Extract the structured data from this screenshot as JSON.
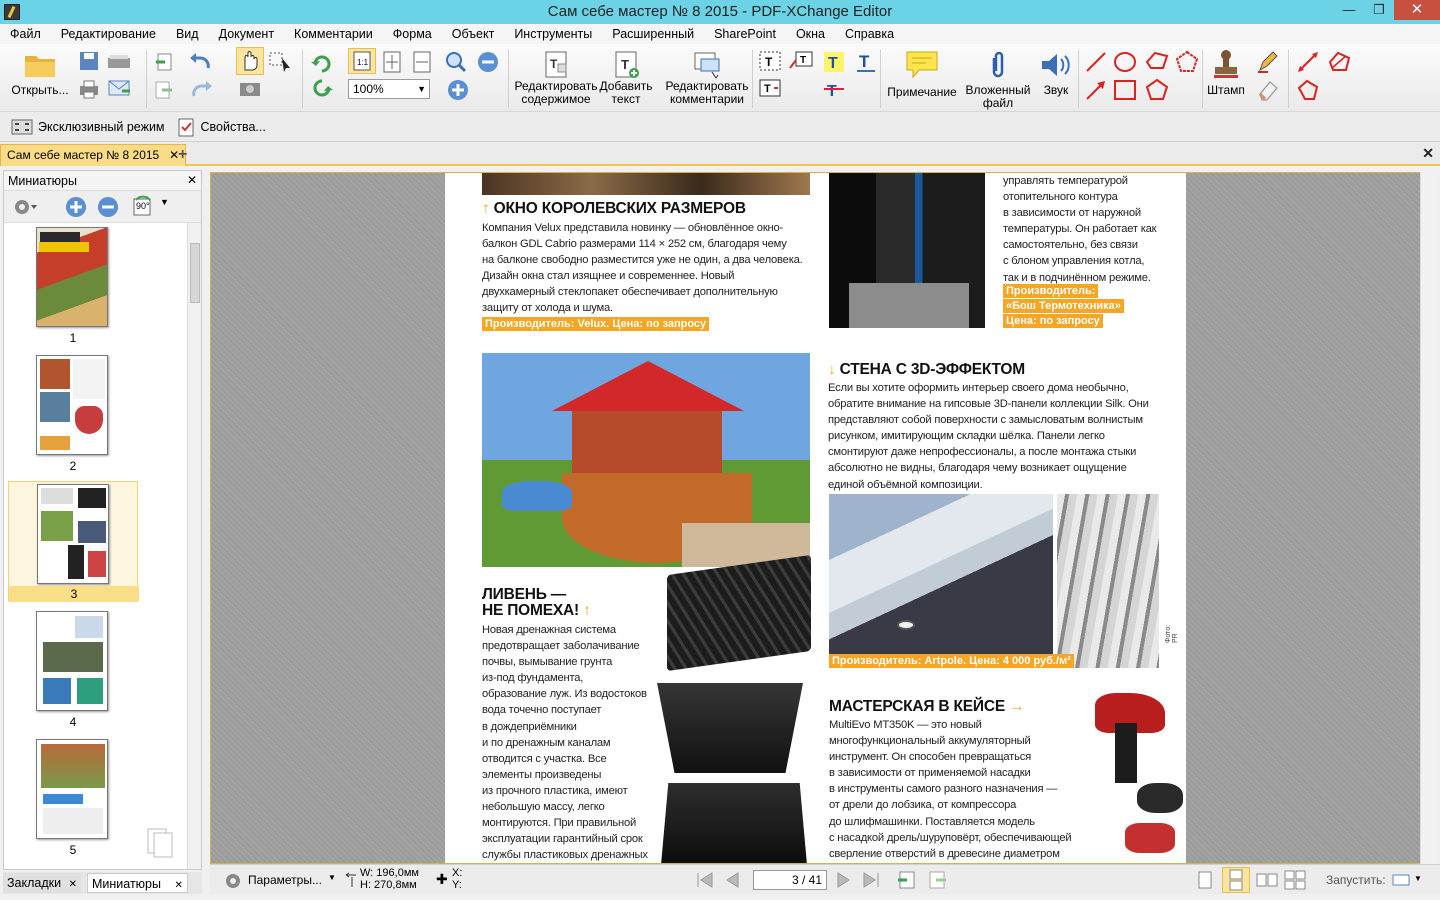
{
  "window": {
    "title": "Сам себе мастер № 8 2015 - PDF-XChange Editor"
  },
  "menu": [
    "Файл",
    "Редактирование",
    "Вид",
    "Документ",
    "Комментарии",
    "Форма",
    "Объект",
    "Инструменты",
    "Расширенный",
    "SharePoint",
    "Окна",
    "Справка"
  ],
  "toolbar": {
    "open": "Открыть...",
    "zoom_value": "100%",
    "edit_content_1": "Редактировать",
    "edit_content_2": "содержимое",
    "add_text_1": "Добавить",
    "add_text_2": "текст",
    "edit_comments_1": "Редактировать",
    "edit_comments_2": "комментарии",
    "note": "Примечание",
    "attach_1": "Вложенный",
    "attach_2": "файл",
    "sound": "Звук",
    "stamp": "Штамп"
  },
  "toolbar2": {
    "exclusive": "Эксклюзивный режим",
    "properties": "Свойства..."
  },
  "tab": {
    "doc": "Сам себе мастер № 8 2015"
  },
  "panel": {
    "title": "Миниатюры",
    "rotate": "90°",
    "thumbs": [
      "1",
      "2",
      "3",
      "4",
      "5"
    ],
    "tab_bookmarks": "Закладки",
    "tab_thumbs": "Миниатюры"
  },
  "article": {
    "h1": "ОКНО КОРОЛЕВСКИХ РАЗМЕРОВ",
    "p1": [
      "Компания Velux представила новинку — обновлённое окно-",
      "балкон GDL Cabrio размерами 114 × 252 см, благодаря чему",
      "на балконе свободно разместится уже не один, а два человека.",
      "Дизайн окна стал изящнее и современнее. Новый",
      "двухкамерный стеклопакет обеспечивает дополнительную",
      "защиту от холода и шума."
    ],
    "tag1": "Производитель: Velux. Цена: по запросу",
    "p_right": [
      "управлять температурой",
      "отопительного контура",
      "в зависимости от наружной",
      "температуры. Он работает как",
      "самостоятельно, без связи",
      "с блоном управления котла,",
      "так и в подчинённом режиме."
    ],
    "tag_r1": "Производитель:",
    "tag_r2": "«Бош Термотехника»",
    "tag_r3": "Цена: по запросу",
    "h2": "СТЕНА С 3D-ЭФФЕКТОМ",
    "p2": [
      "Если вы хотите оформить интерьер своего дома необычно,",
      "обратите внимание на гипсовые 3D-панели коллекции Silk. Они",
      "представляют собой поверхности с замысловатым волнистым",
      "рисунком, имитирующим складки шёлка. Панели легко",
      "смонтируют даже непрофессионалы, а после монтажа стыки",
      "абсолютно не видны, благодаря чему возникает ощущение",
      "единой объёмной композиции."
    ],
    "tag2": "Производитель: Artpole. Цена: 4 000 руб./м²",
    "photo": "Фото: PR",
    "h3a": "ЛИВЕНЬ —",
    "h3b": "НЕ ПОМЕХА!",
    "p3": [
      "Новая дренажная система",
      "предотвращает заболачивание",
      "почвы, вымывание грунта",
      "из-под фундамента,",
      "образование луж. Из водостоков",
      "вода точечно поступает",
      "в дождеприёмники",
      "и по дренажным каналам",
      "отводится с участка. Все",
      "элементы произведены",
      "из прочного пластика, имеют",
      "небольшую массу, легко",
      "монтируются. При правильной",
      "эксплуатации гарантийный срок",
      "службы пластиковых дренажных"
    ],
    "h4": "МАСТЕРСКАЯ В КЕЙСЕ",
    "p4": [
      "MultiEvo MT350K — это новый",
      "многофункциональный аккумуляторный",
      "инструмент. Он способен превращаться",
      "в зависимости от применяемой насадки",
      "в инструменты самого разного назначения —",
      "от дрели до лобзика, от компрессора",
      "до шлифмашинки. Поставляется модель",
      "с насадкой дрель/шуруповёрт, обеспечивающей",
      "сверление отверстий в древесине диаметром"
    ]
  },
  "status": {
    "params": "Параметры...",
    "w": "W: 196,0мм",
    "h": "H: 270,8мм",
    "x": "X:",
    "y": "Y:",
    "page": "3 / 41",
    "launch": "Запустить:"
  }
}
